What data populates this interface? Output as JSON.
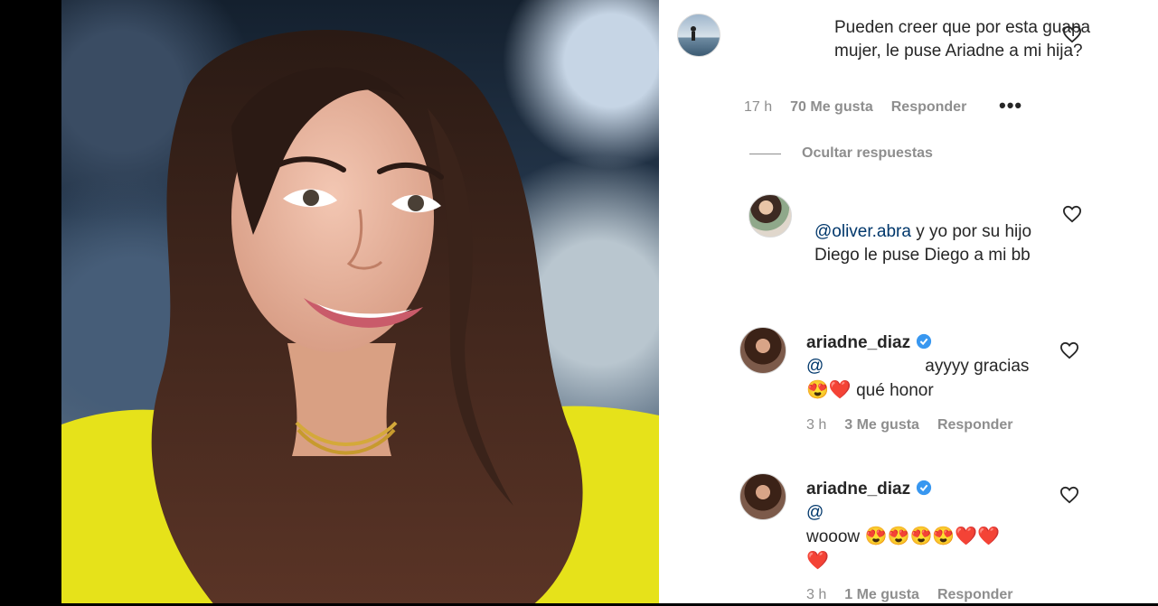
{
  "post": {
    "image_alt": "Smiling woman with long dark hair wearing a yellow top"
  },
  "comments": [
    {
      "text": "Pueden creer que por esta guapa mujer, le puse Ariadne a mi hija?",
      "time": "17 h",
      "likes": "70 Me gusta",
      "reply": "Responder",
      "more": "•••",
      "hide_replies": "Ocultar respuestas"
    }
  ],
  "replies": [
    {
      "mention": "@oliver.abra",
      "text": " y yo por su hijo Diego le puse Diego a mi bb"
    },
    {
      "username": "ariadne_diaz",
      "mention": "@",
      "text": "ayyyy gracias",
      "emojis": "😍❤️",
      "text2": " qué honor",
      "time": "3 h",
      "likes": "3 Me gusta",
      "reply": "Responder"
    },
    {
      "username": "ariadne_diaz",
      "mention": "@",
      "text": "wooow",
      "emojis": " 😍😍😍😍❤️❤️",
      "emojis2": "❤️",
      "time": "3 h",
      "likes": "1 Me gusta",
      "reply": "Responder"
    }
  ]
}
